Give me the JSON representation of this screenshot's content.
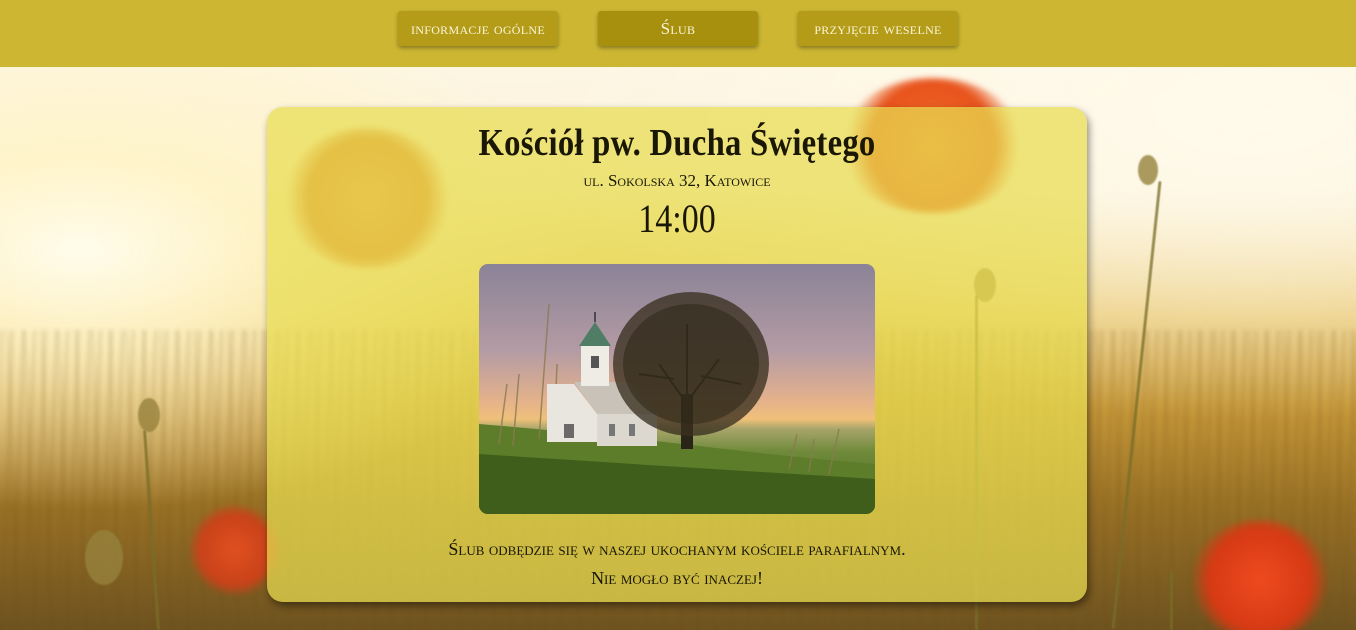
{
  "nav": {
    "items": [
      {
        "label": "informacje ogólne"
      },
      {
        "label": "Ślub"
      },
      {
        "label": "przyjęcie weselne"
      }
    ]
  },
  "ceremony": {
    "title": "Kościół pw. Ducha Świętego",
    "address": "ul. Sokolska 32, Katowice",
    "time": "14:00",
    "description": "Ślub odbędzie się w naszej ukochanym kościele parafialnym. Nie mogło być inaczej!"
  },
  "colors": {
    "topbar": "#cdb732",
    "nav_button": "#b49b18",
    "card": "#e8dc50"
  }
}
